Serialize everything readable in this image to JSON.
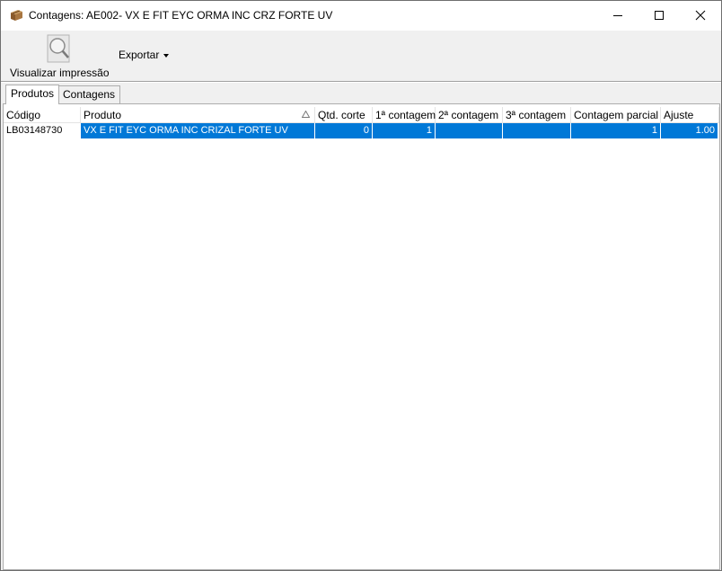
{
  "window": {
    "title": "Contagens: AE002- VX E FIT EYC ORMA INC CRZ FORTE UV"
  },
  "toolbar": {
    "print_label": "Visualizar impressão",
    "export_label": "Exportar"
  },
  "tabs": [
    {
      "label": "Produtos",
      "active": true
    },
    {
      "label": "Contagens",
      "active": false
    }
  ],
  "table": {
    "columns": [
      "Código",
      "Produto",
      "Qtd. corte",
      "1ª contagem",
      "2ª contagem",
      "3ª contagem",
      "Contagem parcial",
      "Ajuste"
    ],
    "sorted_column": "Produto",
    "rows": [
      {
        "codigo": "LB03148730",
        "produto": "VX E FIT EYC ORMA INC CRIZAL FORTE UV",
        "qtd_corte": "0",
        "contagem1": "1",
        "contagem2": "",
        "contagem3": "",
        "contagem_parcial": "1",
        "ajuste": "1.00",
        "selected": true
      }
    ]
  },
  "colors": {
    "selection": "#0078d7",
    "window_bg": "#f0f0f0"
  },
  "icons": {
    "app": "package-icon",
    "print": "magnifier-icon",
    "sort": "sort-ascending-icon"
  }
}
